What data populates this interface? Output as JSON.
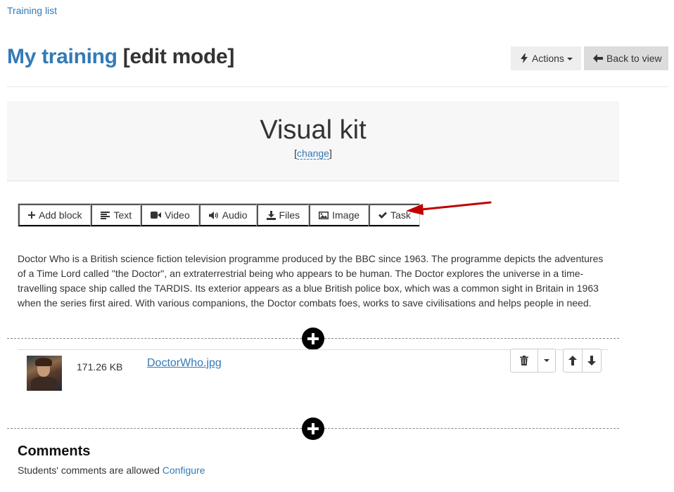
{
  "breadcrumb": {
    "label": "Training list"
  },
  "header": {
    "title_main": "My training",
    "title_suffix": "[edit mode]",
    "actions_label": "Actions",
    "back_label": "Back to view"
  },
  "kit": {
    "title": "Visual kit",
    "change_open": "[",
    "change_label": "change",
    "change_close": "]"
  },
  "toolbar": {
    "items": [
      {
        "label": "Add block",
        "icon": "plus-icon"
      },
      {
        "label": "Text",
        "icon": "align-left-icon"
      },
      {
        "label": "Video",
        "icon": "video-camera-icon"
      },
      {
        "label": "Audio",
        "icon": "volume-icon"
      },
      {
        "label": "Files",
        "icon": "download-icon"
      },
      {
        "label": "Image",
        "icon": "picture-icon"
      },
      {
        "label": "Task",
        "icon": "check-icon"
      }
    ]
  },
  "text_block": {
    "content": "Doctor Who is a British science fiction television programme produced by the BBC since 1963. The programme depicts the adventures of a Time Lord called \"the Doctor\", an extraterrestrial being who appears to be human. The Doctor explores the universe in a time-travelling space ship called the TARDIS. Its exterior appears as a blue British police box, which was a common sight in Britain in 1963 when the series first aired. With various companions, the Doctor combats foes, works to save civilisations and helps people in need."
  },
  "file_block": {
    "size": "171.26 KB",
    "filename": "DoctorWho.jpg"
  },
  "comments": {
    "title": "Comments",
    "status": "Students' comments are allowed",
    "configure_label": "Configure"
  },
  "colors": {
    "link": "#337ab7",
    "annotation_arrow": "#c00000"
  }
}
